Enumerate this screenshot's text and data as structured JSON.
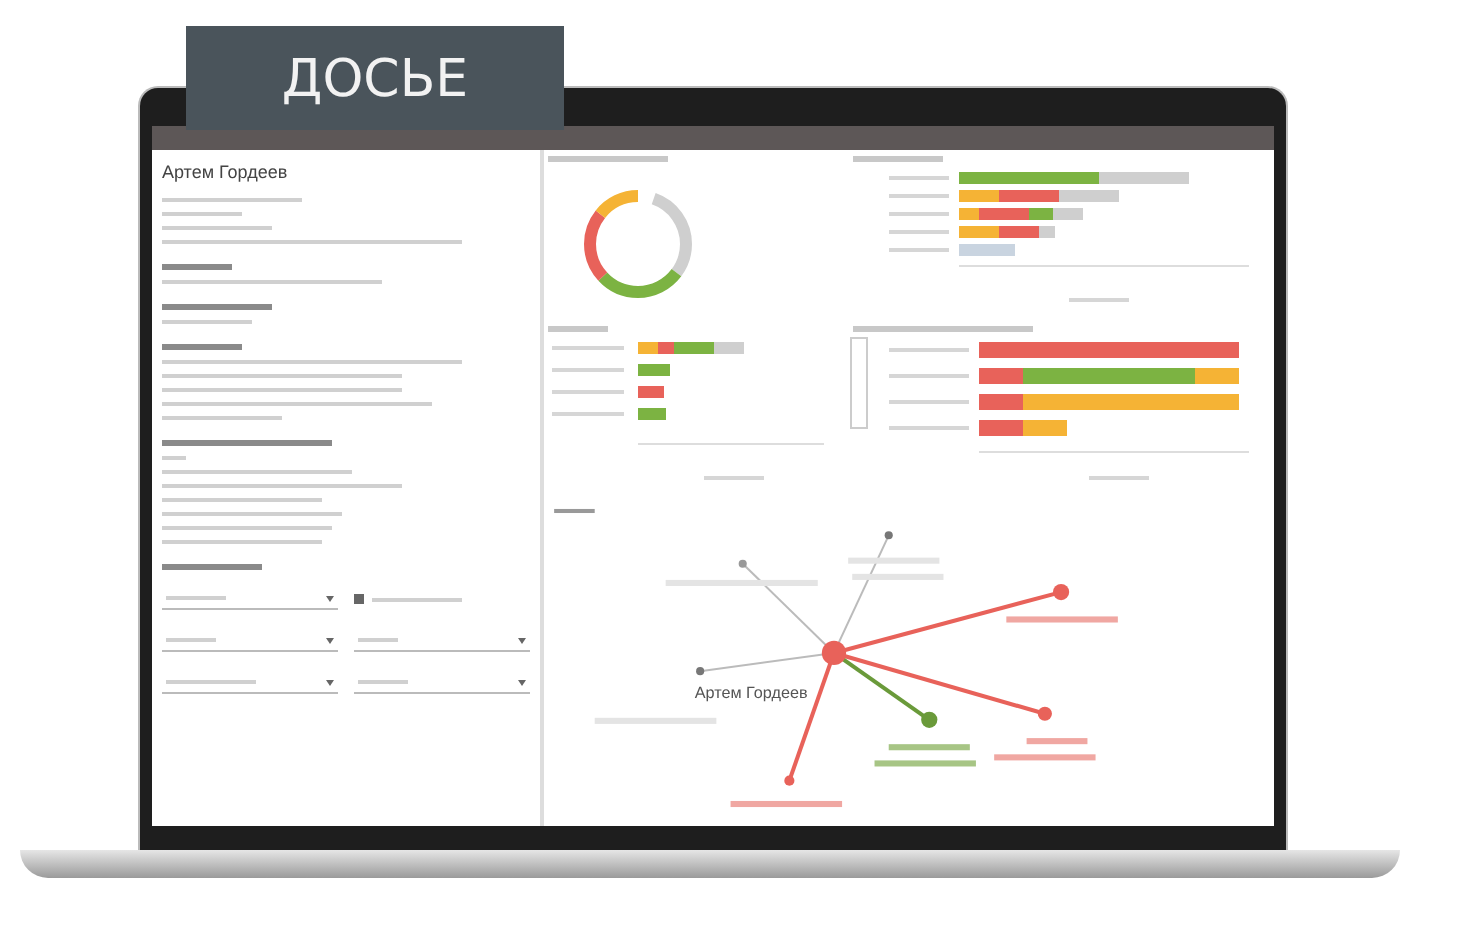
{
  "badge": {
    "label": "ДОСЬЕ"
  },
  "dossier": {
    "name": "Артем Гордеев"
  },
  "network": {
    "center_label": "Артем Гордеев"
  }
}
